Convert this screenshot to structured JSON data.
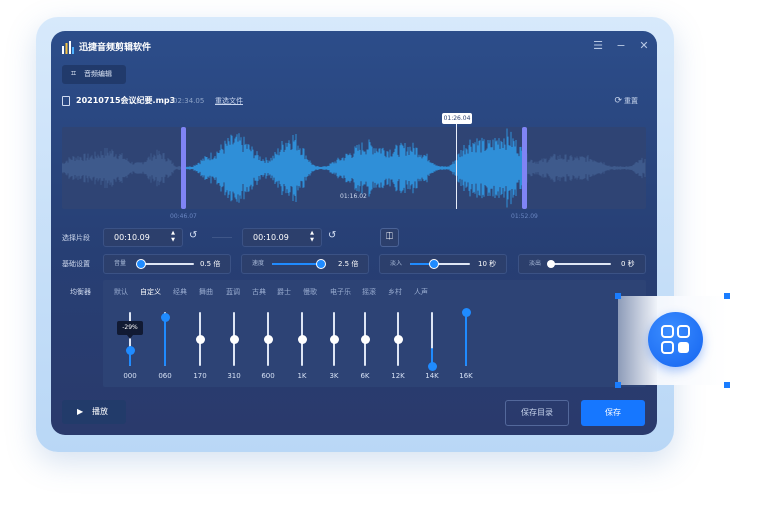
{
  "app": {
    "title": "迅捷音频剪辑软件",
    "controls": {
      "menu": "☰",
      "minimize": "−",
      "close": "✕"
    }
  },
  "toolbar": {
    "audio_edit_label": "音频编辑"
  },
  "file": {
    "name": "20210715会议纪要.mp3",
    "duration": "02:34.05",
    "reselect_label": "重选文件",
    "reset_label": "重置"
  },
  "waveform": {
    "playhead_time": "01:26.04",
    "center_time": "01:16.02",
    "selection_start_marker": "00:46.07",
    "selection_end_marker": "01:52.09",
    "accent_color": "#2f8fd8",
    "selection_handle_color": "#7f84f5"
  },
  "select_segment": {
    "label": "选择片段",
    "start_value": "00:10.09",
    "end_value": "00:10.09"
  },
  "basic_settings": {
    "label": "基础设置",
    "volume": {
      "label": "音量",
      "value": "0.5 倍",
      "level": 0.05
    },
    "speed": {
      "label": "速度",
      "value": "2.5 倍",
      "level": 0.95
    },
    "fade_in": {
      "label": "淡入",
      "value": "10 秒",
      "level": 0.4
    },
    "fade_out": {
      "label": "淡出",
      "value": "0 秒",
      "level": 0.0
    }
  },
  "equalizer": {
    "label": "均衡器",
    "presets": [
      "默认",
      "自定义",
      "经典",
      "舞曲",
      "蓝调",
      "古典",
      "爵士",
      "慢歌",
      "电子乐",
      "摇滚",
      "乡村",
      "人声"
    ],
    "active_preset": "自定义",
    "tooltip": "-29%",
    "bands": [
      {
        "label": "000",
        "level": 0.29
      },
      {
        "label": "060",
        "level": 0.9
      },
      {
        "label": "170",
        "level": 0.5
      },
      {
        "label": "310",
        "level": 0.5
      },
      {
        "label": "600",
        "level": 0.5
      },
      {
        "label": "1K",
        "level": 0.5
      },
      {
        "label": "3K",
        "level": 0.5
      },
      {
        "label": "6K",
        "level": 0.5
      },
      {
        "label": "12K",
        "level": 0.5
      },
      {
        "label": "14K",
        "level": 0.0
      },
      {
        "label": "16K",
        "level": 1.0
      }
    ]
  },
  "actions": {
    "play_label": "播放",
    "save_dir_label": "保存目录",
    "save_label": "保存"
  },
  "colors": {
    "accent": "#1677ff",
    "slider_fill": "#1f8bff"
  }
}
